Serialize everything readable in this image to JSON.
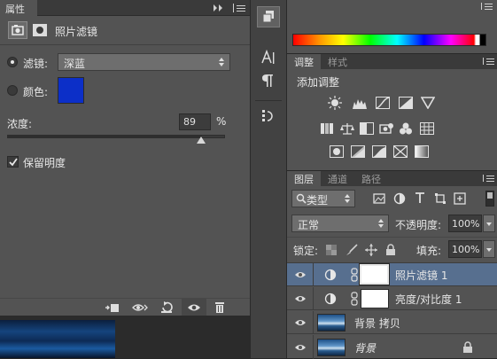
{
  "properties_panel": {
    "tab_label": "属性",
    "header_title": "照片滤镜",
    "filter_label": "滤镜:",
    "filter_value": "深蓝",
    "color_label": "颜色:",
    "color_swatch": "#0c2fc8",
    "density_label": "浓度:",
    "density_value": "89",
    "density_unit": "%",
    "density_percent": 89,
    "preserve_luminosity_label": "保留明度",
    "preserve_luminosity_checked": true
  },
  "adjustments_panel": {
    "tabs": [
      "调整",
      "样式"
    ],
    "title": "添加调整"
  },
  "layers_panel": {
    "tabs": [
      "图层",
      "通道",
      "路径"
    ],
    "filter_kind": "类型",
    "blend_mode": "正常",
    "opacity_label": "不透明度:",
    "opacity_value": "100%",
    "lock_label": "锁定:",
    "fill_label": "填充:",
    "fill_value": "100%",
    "layers": [
      {
        "name": "照片滤镜 1",
        "selected": true
      },
      {
        "name": "亮度/对比度 1",
        "selected": false
      },
      {
        "name": "背景 拷贝",
        "selected": false
      },
      {
        "name": "背景",
        "selected": false
      }
    ]
  },
  "colors": {
    "panel_bg": "#535353",
    "selected_layer": "#576f8f",
    "slider_fill": "#2e2e2e"
  }
}
